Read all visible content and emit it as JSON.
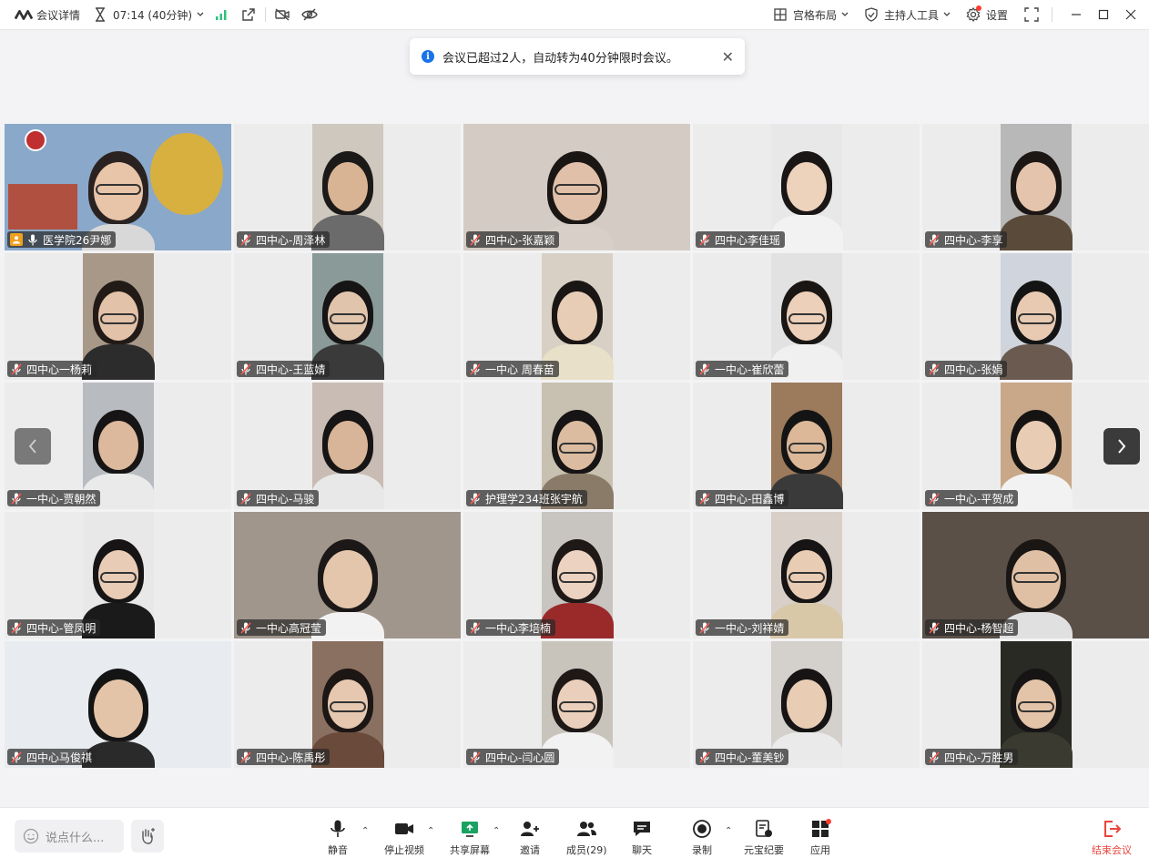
{
  "topbar": {
    "meeting_details": "会议详情",
    "timer": "07:14 (40分钟)",
    "layout": "宫格布局",
    "host_tools": "主持人工具",
    "settings": "设置"
  },
  "toast": {
    "message": "会议已超过2人，自动转为40分钟限时会议。"
  },
  "participants": [
    "医学院26尹娜",
    "四中心-周泽林",
    "四中心-张嘉颖",
    "四中心李佳瑶",
    "四中心-李享",
    "四中心一杨莉",
    "四中心-王蓝婧",
    "一中心 周春苗",
    "一中心-崔欣蕾",
    "四中心-张娟",
    "一中心-贾朝然",
    "四中心-马骏",
    "护理学234班张宇航",
    "四中心-田鑫博",
    "一中心-平贺成",
    "四中心-管凤明",
    "一中心高冠莹",
    "一中心李培楠",
    "一中心-刘祥婧",
    "四中心-杨智超",
    "四中心马俊祺",
    "四中心-陈禹彤",
    "四中心-闫心圆",
    "四中心-董美钞",
    "四中心-万胜男"
  ],
  "bottombar": {
    "chat_placeholder": "说点什么...",
    "mute": "静音",
    "stop_video": "停止视频",
    "share_screen": "共享屏幕",
    "invite": "邀请",
    "members": "成员(29)",
    "chat": "聊天",
    "record": "录制",
    "ai_minutes": "元宝纪要",
    "apps": "应用",
    "end_meeting": "结束会议"
  },
  "colors": {
    "accent_green": "#2ec27e",
    "info_blue": "#1a73e8",
    "end_red": "#e8453c",
    "notification_dot": "#ff3b30"
  }
}
